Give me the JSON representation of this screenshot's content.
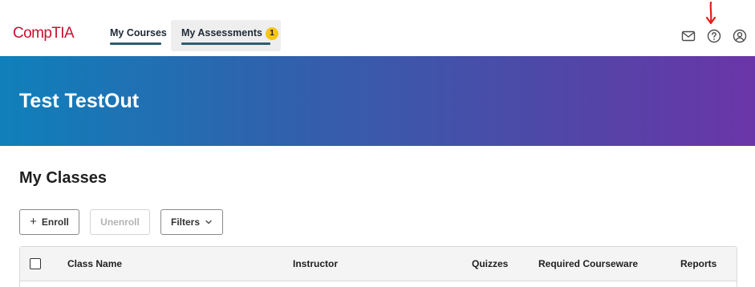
{
  "header": {
    "logo_text": "CompTIA",
    "tabs": [
      {
        "label": "My Courses",
        "active": true
      },
      {
        "label": "My Assessments",
        "active": true,
        "badge": "1"
      }
    ],
    "icons": [
      "mail-icon",
      "help-icon",
      "user-icon"
    ],
    "annotation_arrow_color": "#e0201b",
    "brand_color": "#c8102e",
    "badge_color": "#f5c518"
  },
  "banner": {
    "title": "Test TestOut",
    "gradient_start": "#0f80bb",
    "gradient_end": "#6a35a8"
  },
  "classes": {
    "title": "My Classes",
    "buttons": {
      "enroll": "Enroll",
      "unenroll": "Unenroll",
      "filters": "Filters"
    },
    "table": {
      "columns": [
        "Class Name",
        "Instructor",
        "Quizzes",
        "Required Courseware",
        "Reports"
      ]
    }
  }
}
